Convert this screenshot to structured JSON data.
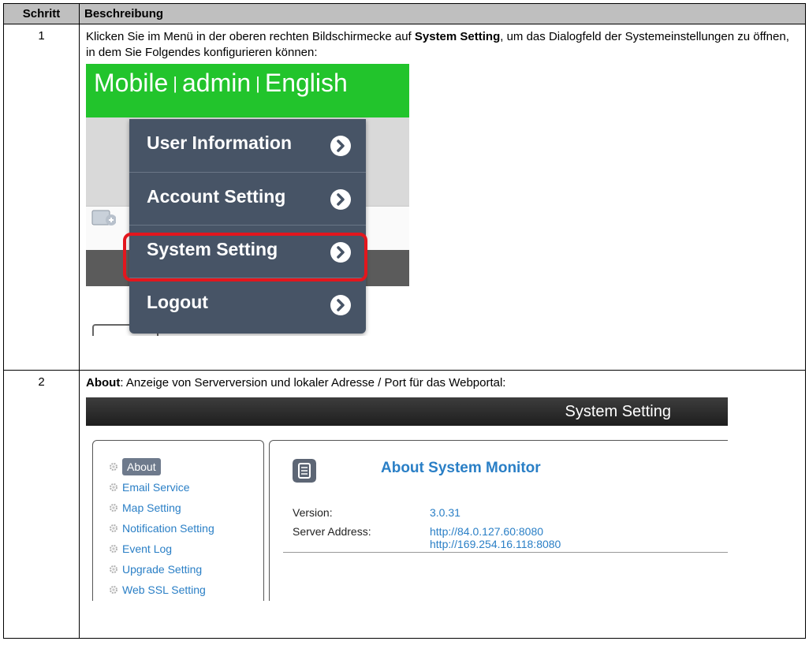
{
  "table": {
    "headers": {
      "step": "Schritt",
      "description": "Beschreibung"
    },
    "rows": [
      {
        "step": "1",
        "text_before": "Klicken Sie im Menü in der oberen rechten Bildschirmecke auf ",
        "keyword": "System Setting",
        "text_after": ", um das Dialogfeld der Systemeinstellungen zu öffnen, in dem Sie Folgendes konfigurieren können:"
      },
      {
        "step": "2",
        "keyword": "About",
        "text_after": ": Anzeige von Serverversion und lokaler Adresse / Port für das Webportal:"
      }
    ]
  },
  "mobile_screenshot": {
    "topbar": {
      "part1": "Mobile",
      "sep": "|",
      "part2": "admin",
      "part3": "English"
    },
    "menu_items": [
      "User Information",
      "Account Setting",
      "System Setting",
      "Logout"
    ],
    "highlighted_item": "System Setting",
    "colors": {
      "topbar": "#22c42c",
      "menu": "#475466",
      "highlight": "#e3161d"
    }
  },
  "system_setting_screenshot": {
    "header_title": "System Setting",
    "nav_items": [
      "About",
      "Email Service",
      "Map Setting",
      "Notification Setting",
      "Event Log",
      "Upgrade Setting",
      "Web SSL Setting"
    ],
    "active_nav": "About",
    "panel_title": "About System Monitor",
    "version_label": "Version:",
    "version_value": "3.0.31",
    "server_address_label": "Server Address:",
    "server_address_values": [
      "http://84.0.127.60:8080",
      "http://169.254.16.118:8080"
    ]
  }
}
